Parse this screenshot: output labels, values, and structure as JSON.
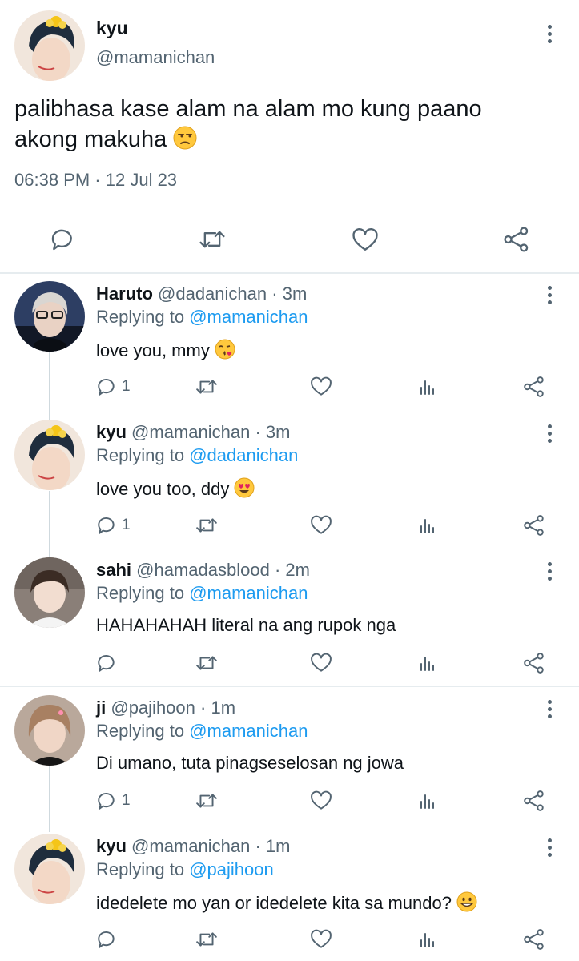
{
  "main_tweet": {
    "display_name": "kyu",
    "handle": "@mamanichan",
    "text": "palibhasa kase alam na alam mo kung paano akong makuha",
    "emoji": "😒",
    "time": "06:38 PM",
    "separator": "·",
    "date": "12 Jul 23"
  },
  "replies": [
    {
      "name": "Haruto",
      "handle": "@dadanichan",
      "time": "3m",
      "replying_label": "Replying to",
      "replying_to": "@mamanichan",
      "text": "love you, mmy",
      "emoji": "😘",
      "reply_count": "1"
    },
    {
      "name": "kyu",
      "handle": "@mamanichan",
      "time": "3m",
      "replying_label": "Replying to",
      "replying_to": "@dadanichan",
      "text": "love you too, ddy",
      "emoji": "😍",
      "reply_count": "1"
    },
    {
      "name": "sahi",
      "handle": "@hamadasblood",
      "time": "2m",
      "replying_label": "Replying to",
      "replying_to": "@mamanichan",
      "text": "HAHAHAHAH literal na ang rupok nga",
      "emoji": "",
      "reply_count": ""
    },
    {
      "name": "ji",
      "handle": "@pajihoon",
      "time": "1m",
      "replying_label": "Replying to",
      "replying_to": "@mamanichan",
      "text": "Di umano, tuta pinagseselosan ng jowa",
      "emoji": "",
      "reply_count": "1"
    },
    {
      "name": "kyu",
      "handle": "@mamanichan",
      "time": "1m",
      "replying_label": "Replying to",
      "replying_to": "@pajihoon",
      "text": "idedelete mo yan or idedelete kita sa mundo?",
      "emoji": "😀",
      "reply_count": ""
    }
  ],
  "icons": {
    "reply": "reply-icon",
    "retweet": "retweet-icon",
    "like": "heart-icon",
    "views": "views-icon",
    "share": "share-icon",
    "more": "more-icon"
  },
  "colors": {
    "text": "#0f1419",
    "muted": "#536471",
    "link": "#1d9bf0",
    "divider": "#eff3f4",
    "thread_line": "#cfd9de"
  }
}
